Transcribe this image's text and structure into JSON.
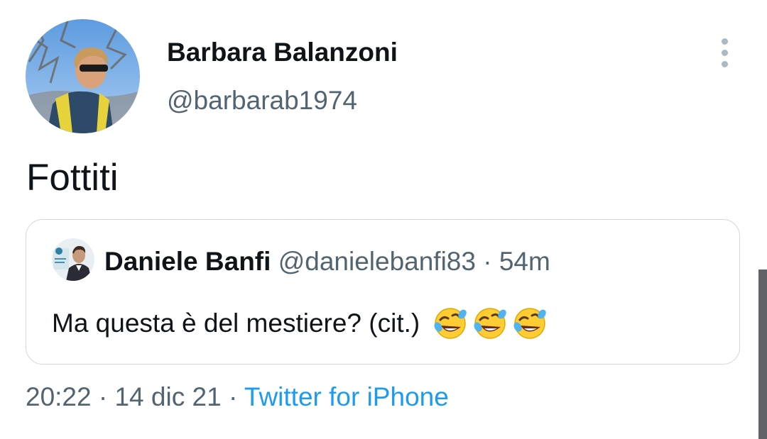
{
  "tweet": {
    "author_name": "Barbara Balanzoni",
    "author_handle": "@barbarab1974",
    "text": "Fottiti",
    "time": "20:22",
    "date": "14 dic 21",
    "separator": "·",
    "source": "Twitter for iPhone"
  },
  "quoted": {
    "author_name": "Daniele Banfi",
    "author_handle": "@danielebanfi83",
    "separator": "·",
    "age": "54m",
    "text": "Ma questa è del mestiere? (cit.)",
    "emojis": [
      "rolling-on-floor-laughing",
      "rolling-on-floor-laughing",
      "rolling-on-floor-laughing"
    ]
  },
  "colors": {
    "link": "#1d9bf0",
    "secondary_text": "#536471",
    "border": "#cfd9de"
  }
}
